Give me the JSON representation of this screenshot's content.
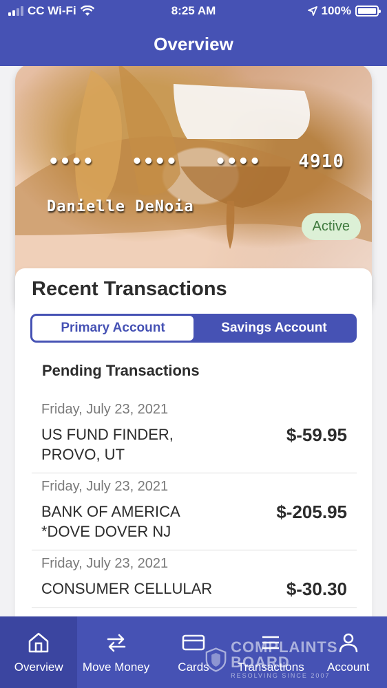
{
  "status": {
    "carrier": "CC Wi-Fi",
    "time": "8:25 AM",
    "battery": "100%"
  },
  "header": {
    "title": "Overview"
  },
  "card": {
    "number": [
      "••••",
      "••••",
      "••••",
      "4910"
    ],
    "holder": "Danielle DeNoia",
    "status": "Active"
  },
  "transactions": {
    "title": "Recent Transactions",
    "tabs": [
      "Primary Account",
      "Savings Account"
    ],
    "selected_tab": "Primary Account",
    "pending_title": "Pending Transactions",
    "items": [
      {
        "date": "Friday, July 23, 2021",
        "merchant": "US FUND FINDER, PROVO, UT",
        "amount": "$-59.95"
      },
      {
        "date": "Friday, July 23, 2021",
        "merchant": "BANK OF AMERICA *DOVE DOVER NJ",
        "amount": "$-205.95"
      },
      {
        "date": "Friday, July 23, 2021",
        "merchant": "CONSUMER CELLULAR",
        "amount": "$-30.30"
      }
    ]
  },
  "tabbar": {
    "items": [
      {
        "label": "Overview",
        "icon": "home-icon"
      },
      {
        "label": "Move Money",
        "icon": "transfer-icon"
      },
      {
        "label": "Cards",
        "icon": "card-icon"
      },
      {
        "label": "Transactions",
        "icon": "list-icon"
      },
      {
        "label": "Account",
        "icon": "person-icon"
      }
    ],
    "active": "Overview"
  },
  "watermark": {
    "title": "COMPLAINTS BOARD",
    "tagline": "RESOLVING SINCE 2007"
  },
  "colors": {
    "primary": "#4652b4",
    "active_badge_bg": "#dcf0d6",
    "active_badge_text": "#3f7a3e"
  }
}
